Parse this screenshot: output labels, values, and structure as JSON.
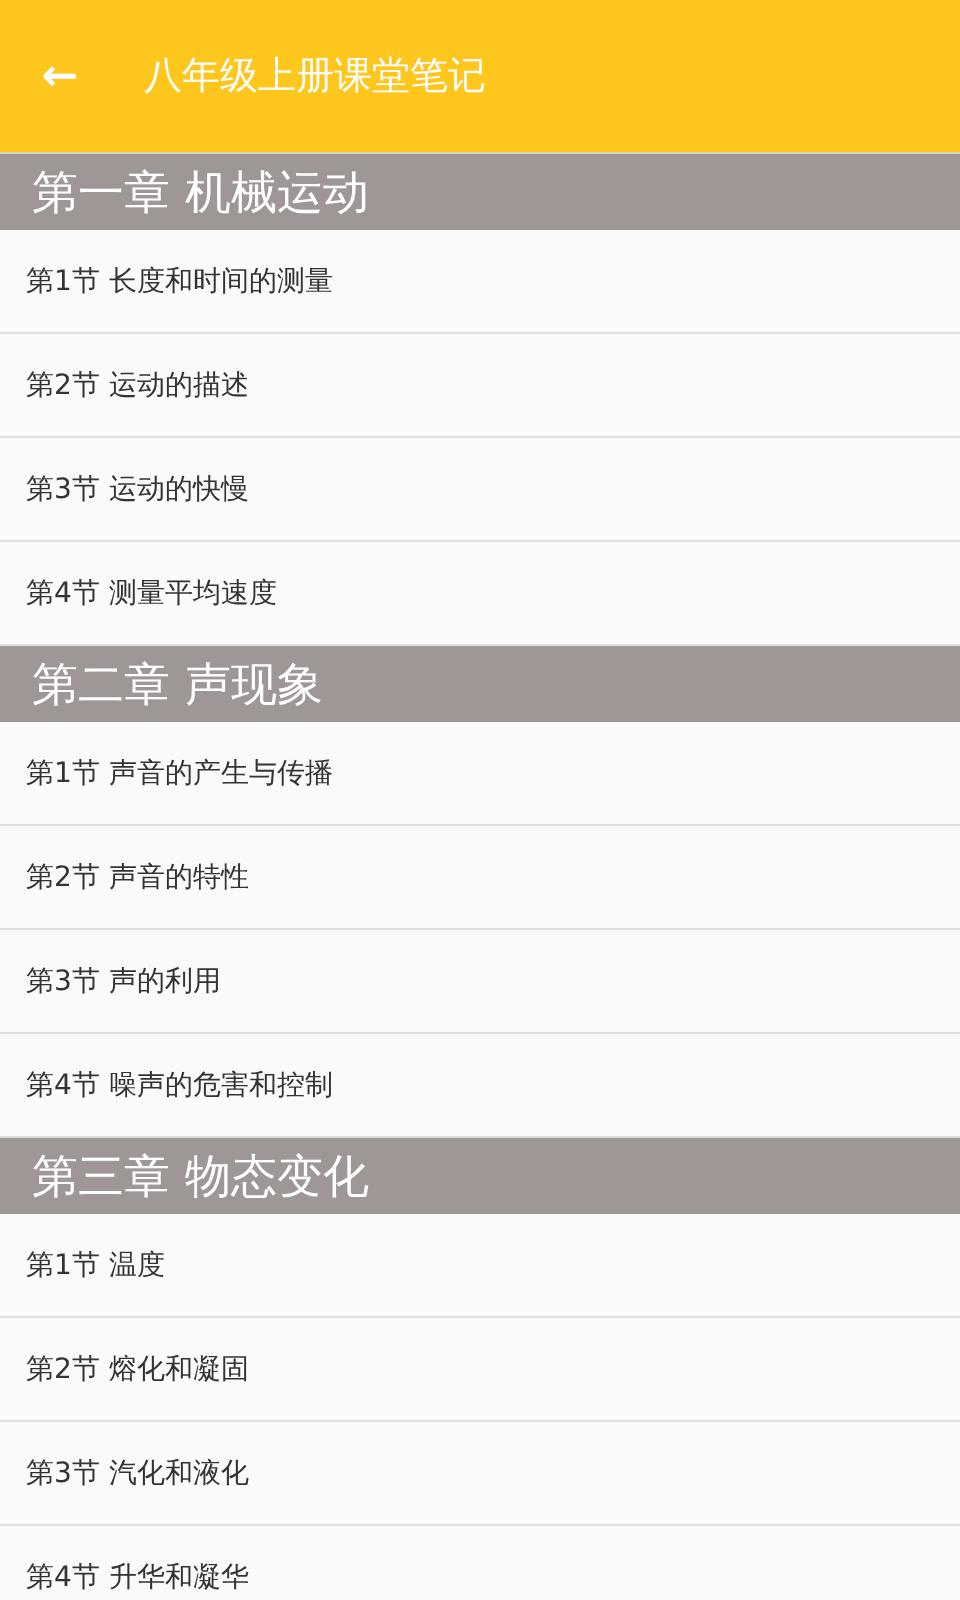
{
  "app_bar": {
    "back_icon": "←",
    "title": "八年级上册课堂笔记"
  },
  "chapters": [
    {
      "title": "第一章 机械运动",
      "sections": [
        "第1节 长度和时间的测量",
        "第2节 运动的描述",
        "第3节 运动的快慢",
        "第4节 测量平均速度"
      ]
    },
    {
      "title": "第二章 声现象",
      "sections": [
        "第1节 声音的产生与传播",
        "第2节 声音的特性",
        "第3节 声的利用",
        "第4节 噪声的危害和控制"
      ]
    },
    {
      "title": "第三章 物态变化",
      "sections": [
        "第1节 温度",
        "第2节 熔化和凝固",
        "第3节 汽化和液化",
        "第4节 升华和凝华"
      ]
    }
  ]
}
